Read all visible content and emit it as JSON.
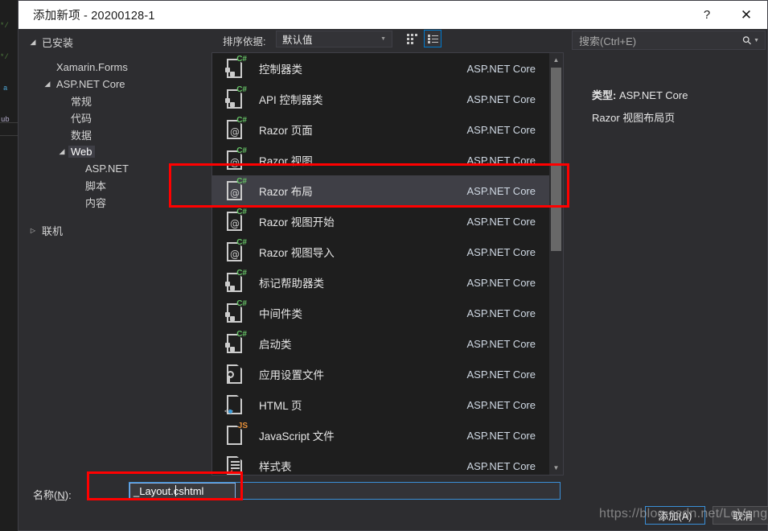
{
  "window": {
    "title": "添加新项 - 20200128-1",
    "help_label": "?",
    "close_label": "✕"
  },
  "sidebar": {
    "items": [
      {
        "label": "已安装",
        "arrow": "▲",
        "indent": 0,
        "expanded": true,
        "selected": false
      },
      {
        "label": "Xamarin.Forms",
        "arrow": "",
        "indent": 1,
        "expanded": false,
        "selected": false
      },
      {
        "label": "ASP.NET Core",
        "arrow": "▲",
        "indent": 1,
        "expanded": true,
        "selected": false
      },
      {
        "label": "常规",
        "arrow": "",
        "indent": 2,
        "expanded": false,
        "selected": false
      },
      {
        "label": "代码",
        "arrow": "",
        "indent": 2,
        "expanded": false,
        "selected": false
      },
      {
        "label": "数据",
        "arrow": "",
        "indent": 2,
        "expanded": false,
        "selected": false
      },
      {
        "label": "Web",
        "arrow": "▲",
        "indent": 2,
        "expanded": true,
        "selected": true
      },
      {
        "label": "ASP.NET",
        "arrow": "",
        "indent": 3,
        "expanded": false,
        "selected": false
      },
      {
        "label": "脚本",
        "arrow": "",
        "indent": 3,
        "expanded": false,
        "selected": false
      },
      {
        "label": "内容",
        "arrow": "",
        "indent": 3,
        "expanded": false,
        "selected": false
      },
      {
        "label": "联机",
        "arrow": "▶",
        "indent": 0,
        "expanded": false,
        "selected": false
      }
    ]
  },
  "toolbar": {
    "sort_label": "排序依据:",
    "sort_value": "默认值",
    "sort_caret": "▼",
    "view_grid_name": "grid-view",
    "view_list_name": "list-view"
  },
  "search": {
    "placeholder": "搜索(Ctrl+E)",
    "caret": "▼"
  },
  "list": {
    "items": [
      {
        "name": "控制器类",
        "category": "ASP.NET Core",
        "icon": "csharp-puzzle-file-icon",
        "selected": false
      },
      {
        "name": "API 控制器类",
        "category": "ASP.NET Core",
        "icon": "csharp-puzzle-file-icon",
        "selected": false
      },
      {
        "name": "Razor 页面",
        "category": "ASP.NET Core",
        "icon": "csharp-razor-file-icon",
        "selected": false
      },
      {
        "name": "Razor 视图",
        "category": "ASP.NET Core",
        "icon": "csharp-razor-file-icon",
        "selected": false
      },
      {
        "name": "Razor 布局",
        "category": "ASP.NET Core",
        "icon": "csharp-razor-file-icon",
        "selected": true
      },
      {
        "name": "Razor 视图开始",
        "category": "ASP.NET Core",
        "icon": "csharp-razor-file-icon",
        "selected": false
      },
      {
        "name": "Razor 视图导入",
        "category": "ASP.NET Core",
        "icon": "csharp-razor-file-icon",
        "selected": false
      },
      {
        "name": "标记帮助器类",
        "category": "ASP.NET Core",
        "icon": "csharp-puzzle-file-icon",
        "selected": false
      },
      {
        "name": "中间件类",
        "category": "ASP.NET Core",
        "icon": "csharp-puzzle-file-icon",
        "selected": false
      },
      {
        "name": "启动类",
        "category": "ASP.NET Core",
        "icon": "csharp-puzzle-file-icon",
        "selected": false
      },
      {
        "name": "应用设置文件",
        "category": "ASP.NET Core",
        "icon": "settings-file-icon",
        "selected": false
      },
      {
        "name": "HTML 页",
        "category": "ASP.NET Core",
        "icon": "html-file-icon",
        "selected": false
      },
      {
        "name": "JavaScript 文件",
        "category": "ASP.NET Core",
        "icon": "javascript-file-icon",
        "selected": false
      },
      {
        "name": "样式表",
        "category": "ASP.NET Core",
        "icon": "stylesheet-file-icon",
        "selected": false
      }
    ],
    "scroll_up": "▲",
    "scroll_down": "▼"
  },
  "details": {
    "type_label": "类型:",
    "type_value": "ASP.NET Core",
    "description": "Razor 视图布局页"
  },
  "footer": {
    "name_label_prefix": "名称(",
    "name_label_key": "N",
    "name_label_suffix": "):",
    "name_value": "_Layout.cshtml",
    "add_label": "添加(A)",
    "cancel_label": "取消"
  },
  "annotations": {
    "watermark": "https://blog.csdn.net/LcVong",
    "highlight_color": "#ff0000"
  },
  "background_editor": {
    "lines": [
      "*/",
      "*/",
      "a",
      "ub"
    ]
  }
}
